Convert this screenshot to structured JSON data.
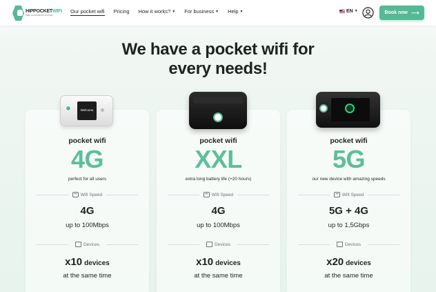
{
  "header": {
    "logo": {
      "name_part1": "HIPPOCKET",
      "name_part2": "WIFI",
      "tagline": "stay connected in Europe"
    },
    "nav": [
      {
        "label": "Our pocket wifi",
        "has_caret": false
      },
      {
        "label": "Pricing",
        "has_caret": false
      },
      {
        "label": "How it works?",
        "has_caret": true
      },
      {
        "label": "For business",
        "has_caret": true
      },
      {
        "label": "Help",
        "has_caret": true
      }
    ],
    "language": "EN",
    "book_button": "Book now",
    "icons": {
      "user": "user-circle-icon",
      "arrow": "arrow-right-icon",
      "caret": "caret-down-icon",
      "flag": "us-flag-icon"
    }
  },
  "hero": {
    "title_line1": "We have a pocket wifi for",
    "title_line2": "every needs!"
  },
  "plans": [
    {
      "name": "pocket wifi",
      "big_label": "4G",
      "tagline": "perfect for all users",
      "screen_text": "Welcome",
      "wifi_speed_heading": "Wifi Speed",
      "speed_main": "4G",
      "speed_sub": "up to 100Mbps",
      "devices_heading": "Devices",
      "devices_count": "x10",
      "devices_word": "devices",
      "devices_sub": "at the same time"
    },
    {
      "name": "pocket wifi",
      "big_label": "XXL",
      "tagline": "extra long battery life (+20 hours)",
      "wifi_speed_heading": "Wifi Speed",
      "speed_main": "4G",
      "speed_sub": "up to 100Mbps",
      "devices_heading": "Devices",
      "devices_count": "x10",
      "devices_word": "devices",
      "devices_sub": "at the same time"
    },
    {
      "name": "pocket wifi",
      "big_label": "5G",
      "tagline": "our new device with amazing speeds",
      "wifi_speed_heading": "Wifi Speed",
      "speed_main": "5G + 4G",
      "speed_sub": "up to 1,5Gbps",
      "devices_heading": "Devices",
      "devices_count": "x20",
      "devices_word": "devices",
      "devices_sub": "at the same time"
    }
  ],
  "colors": {
    "accent": "#55b996",
    "accent_light": "#5cbf98",
    "text": "#1d2320",
    "background": "#edf4f0"
  }
}
